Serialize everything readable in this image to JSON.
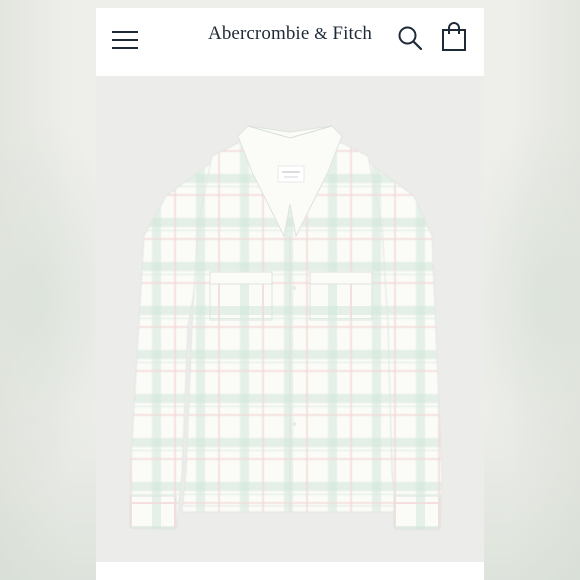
{
  "header": {
    "brand_main": "Abercrombie",
    "brand_amp": "&",
    "brand_tail": "Fitch",
    "menu_icon": "hamburger-menu-icon",
    "search_icon": "search-icon",
    "bag_icon": "shopping-bag-icon"
  },
  "product": {
    "image": "product-shirt-image",
    "colors": {
      "fabric": "#fbfbf8",
      "plaid_mint": "#cfe5d8",
      "plaid_pink": "#f3dcdc",
      "background": "#ececea"
    }
  }
}
